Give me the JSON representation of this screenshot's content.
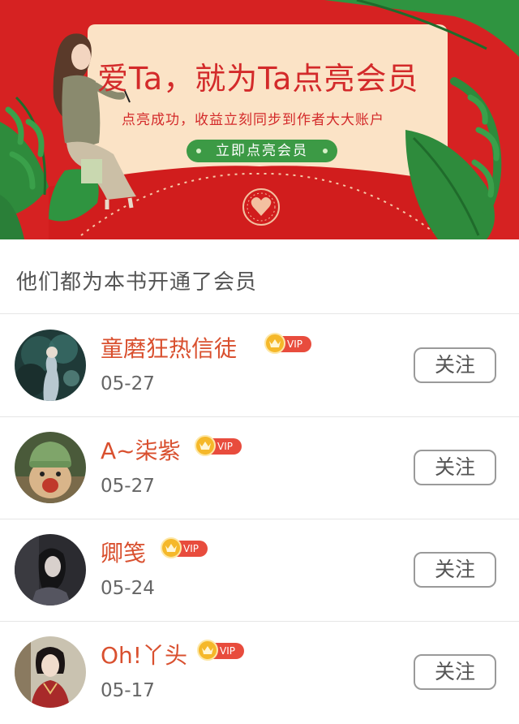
{
  "banner": {
    "title": "爱Ta，就为Ta点亮会员",
    "subtitle": "点亮成功，收益立刻同步到作者大大账户",
    "button_label": "立即点亮会员",
    "colors": {
      "background": "#d32020",
      "card": "#fbe3c6",
      "accent_green": "#3c9a45"
    }
  },
  "section": {
    "title": "他们都为本书开通了会员"
  },
  "vip_label": "VIP",
  "members": [
    {
      "name": "童磨狂热信徒",
      "date": "05-27",
      "follow_label": "关注"
    },
    {
      "name": "A~柒紫",
      "date": "05-27",
      "follow_label": "关注"
    },
    {
      "name": "卿笺",
      "date": "05-24",
      "follow_label": "关注"
    },
    {
      "name": "Oh!丫头",
      "date": "05-17",
      "follow_label": "关注"
    }
  ]
}
